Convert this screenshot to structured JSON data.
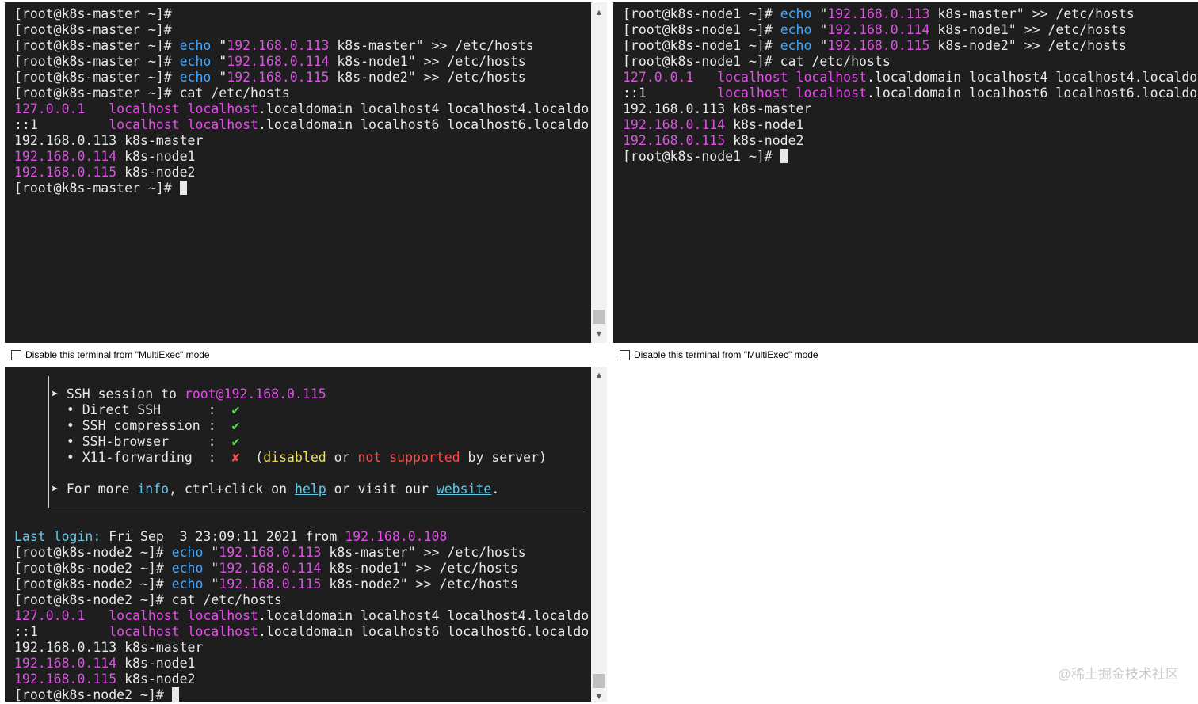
{
  "multiexec_label": "Disable this terminal from \"MultiExec\" mode",
  "watermark": "@稀土掘金技术社区",
  "icons": {
    "scroll_up": "scroll-up-icon",
    "scroll_down": "scroll-down-icon",
    "checkbox": "checkbox-icon"
  },
  "colors": {
    "terminal_bg": "#1e1e1e",
    "text": "#e8e8e8",
    "magenta": "#e14ee8",
    "blue": "#4aa6f5",
    "green": "#52e052",
    "red": "#ff4a4a",
    "yellow": "#f0e05a",
    "light_blue": "#65c9e8"
  },
  "terminals": [
    {
      "host": "k8s-master",
      "lines": [
        [
          {
            "t": "[root@k8s-master ~]#"
          }
        ],
        [
          {
            "t": "[root@k8s-master ~]#"
          }
        ],
        [
          {
            "t": "[root@k8s-master ~]# "
          },
          {
            "t": "echo",
            "c": "b"
          },
          {
            "t": " \""
          },
          {
            "t": "192.168.0.113",
            "c": "m"
          },
          {
            "t": " k8s-master\" >> /etc/hosts"
          }
        ],
        [
          {
            "t": "[root@k8s-master ~]# "
          },
          {
            "t": "echo",
            "c": "b"
          },
          {
            "t": " \""
          },
          {
            "t": "192.168.0.114",
            "c": "m"
          },
          {
            "t": " k8s-node1\" >> /etc/hosts"
          }
        ],
        [
          {
            "t": "[root@k8s-master ~]# "
          },
          {
            "t": "echo",
            "c": "b"
          },
          {
            "t": " \""
          },
          {
            "t": "192.168.0.115",
            "c": "m"
          },
          {
            "t": " k8s-node2\" >> /etc/hosts"
          }
        ],
        [
          {
            "t": "[root@k8s-master ~]# cat /etc/hosts"
          }
        ],
        [
          {
            "t": "127.0.0.1",
            "c": "m"
          },
          {
            "t": "   "
          },
          {
            "t": "localhost",
            "c": "m"
          },
          {
            "t": " "
          },
          {
            "t": "localhost",
            "c": "m"
          },
          {
            "t": ".localdomain localhost4 localhost4.localdo"
          }
        ],
        [
          {
            "t": "::1         "
          },
          {
            "t": "localhost",
            "c": "m"
          },
          {
            "t": " "
          },
          {
            "t": "localhost",
            "c": "m"
          },
          {
            "t": ".localdomain localhost6 localhost6.localdo"
          }
        ],
        [
          {
            "t": "192.168.0.113 k8s-master"
          }
        ],
        [
          {
            "t": "192.168.0.114",
            "c": "m"
          },
          {
            "t": " k8s-node1"
          }
        ],
        [
          {
            "t": "192.168.0.115",
            "c": "m"
          },
          {
            "t": " k8s-node2"
          }
        ],
        [
          {
            "t": "[root@k8s-master ~]# "
          },
          {
            "cursor": true
          }
        ]
      ]
    },
    {
      "host": "k8s-node1",
      "lines": [
        [
          {
            "t": "[root@k8s-node1 ~]# "
          },
          {
            "t": "echo",
            "c": "b"
          },
          {
            "t": " \""
          },
          {
            "t": "192.168.0.113",
            "c": "m"
          },
          {
            "t": " k8s-master\" >> /etc/hosts"
          }
        ],
        [
          {
            "t": "[root@k8s-node1 ~]# "
          },
          {
            "t": "echo",
            "c": "b"
          },
          {
            "t": " \""
          },
          {
            "t": "192.168.0.114",
            "c": "m"
          },
          {
            "t": " k8s-node1\" >> /etc/hosts"
          }
        ],
        [
          {
            "t": "[root@k8s-node1 ~]# "
          },
          {
            "t": "echo",
            "c": "b"
          },
          {
            "t": " \""
          },
          {
            "t": "192.168.0.115",
            "c": "m"
          },
          {
            "t": " k8s-node2\" >> /etc/hosts"
          }
        ],
        [
          {
            "t": "[root@k8s-node1 ~]# cat /etc/hosts"
          }
        ],
        [
          {
            "t": "127.0.0.1",
            "c": "m"
          },
          {
            "t": "   "
          },
          {
            "t": "localhost",
            "c": "m"
          },
          {
            "t": " "
          },
          {
            "t": "localhost",
            "c": "m"
          },
          {
            "t": ".localdomain localhost4 localhost4.localdo"
          }
        ],
        [
          {
            "t": "::1         "
          },
          {
            "t": "localhost",
            "c": "m"
          },
          {
            "t": " "
          },
          {
            "t": "localhost",
            "c": "m"
          },
          {
            "t": ".localdomain localhost6 localhost6.localdo"
          }
        ],
        [
          {
            "t": "192.168.0.113 k8s-master"
          }
        ],
        [
          {
            "t": "192.168.0.114",
            "c": "m"
          },
          {
            "t": " k8s-node1"
          }
        ],
        [
          {
            "t": "192.168.0.115",
            "c": "m"
          },
          {
            "t": " k8s-node2"
          }
        ],
        [
          {
            "t": "[root@k8s-node1 ~]# "
          },
          {
            "cursor": true
          }
        ]
      ]
    },
    {
      "host": "k8s-node2",
      "banner": [
        [
          {
            "t": "➤ SSH session to "
          },
          {
            "t": "root@192.168.0.115",
            "c": "m"
          }
        ],
        [
          {
            "t": "  • Direct SSH      :  "
          },
          {
            "t": "✔",
            "c": "g"
          }
        ],
        [
          {
            "t": "  • SSH compression :  "
          },
          {
            "t": "✔",
            "c": "g"
          }
        ],
        [
          {
            "t": "  • SSH-browser     :  "
          },
          {
            "t": "✔",
            "c": "g"
          }
        ],
        [
          {
            "t": "  • X11-forwarding  :  "
          },
          {
            "t": "✘",
            "c": "r"
          },
          {
            "t": "  ("
          },
          {
            "t": "disabled",
            "c": "y"
          },
          {
            "t": " or "
          },
          {
            "t": "not supported",
            "c": "r"
          },
          {
            "t": " by server)"
          }
        ],
        [
          {
            "t": ""
          }
        ],
        [
          {
            "t": "➤ For more "
          },
          {
            "t": "info",
            "c": "lb"
          },
          {
            "t": ", ctrl+click on "
          },
          {
            "t": "help",
            "c": "u"
          },
          {
            "t": " or visit our "
          },
          {
            "t": "website",
            "c": "u"
          },
          {
            "t": "."
          }
        ]
      ],
      "lines": [
        [
          {
            "t": "Last login:",
            "c": "lb"
          },
          {
            "t": " Fri Sep  3 23:09:11 2021 from "
          },
          {
            "t": "192.168.0.108",
            "c": "m"
          }
        ],
        [
          {
            "t": "[root@k8s-node2 ~]# "
          },
          {
            "t": "echo",
            "c": "b"
          },
          {
            "t": " \""
          },
          {
            "t": "192.168.0.113",
            "c": "m"
          },
          {
            "t": " k8s-master\" >> /etc/hosts"
          }
        ],
        [
          {
            "t": "[root@k8s-node2 ~]# "
          },
          {
            "t": "echo",
            "c": "b"
          },
          {
            "t": " \""
          },
          {
            "t": "192.168.0.114",
            "c": "m"
          },
          {
            "t": " k8s-node1\" >> /etc/hosts"
          }
        ],
        [
          {
            "t": "[root@k8s-node2 ~]# "
          },
          {
            "t": "echo",
            "c": "b"
          },
          {
            "t": " \""
          },
          {
            "t": "192.168.0.115",
            "c": "m"
          },
          {
            "t": " k8s-node2\" >> /etc/hosts"
          }
        ],
        [
          {
            "t": "[root@k8s-node2 ~]# cat /etc/hosts"
          }
        ],
        [
          {
            "t": "127.0.0.1",
            "c": "m"
          },
          {
            "t": "   "
          },
          {
            "t": "localhost",
            "c": "m"
          },
          {
            "t": " "
          },
          {
            "t": "localhost",
            "c": "m"
          },
          {
            "t": ".localdomain localhost4 localhost4.localdo"
          }
        ],
        [
          {
            "t": "::1         "
          },
          {
            "t": "localhost",
            "c": "m"
          },
          {
            "t": " "
          },
          {
            "t": "localhost",
            "c": "m"
          },
          {
            "t": ".localdomain localhost6 localhost6.localdo"
          }
        ],
        [
          {
            "t": "192.168.0.113 k8s-master"
          }
        ],
        [
          {
            "t": "192.168.0.114",
            "c": "m"
          },
          {
            "t": " k8s-node1"
          }
        ],
        [
          {
            "t": "192.168.0.115",
            "c": "m"
          },
          {
            "t": " k8s-node2"
          }
        ],
        [
          {
            "t": "[root@k8s-node2 ~]# "
          },
          {
            "cursor": true
          }
        ]
      ]
    }
  ]
}
